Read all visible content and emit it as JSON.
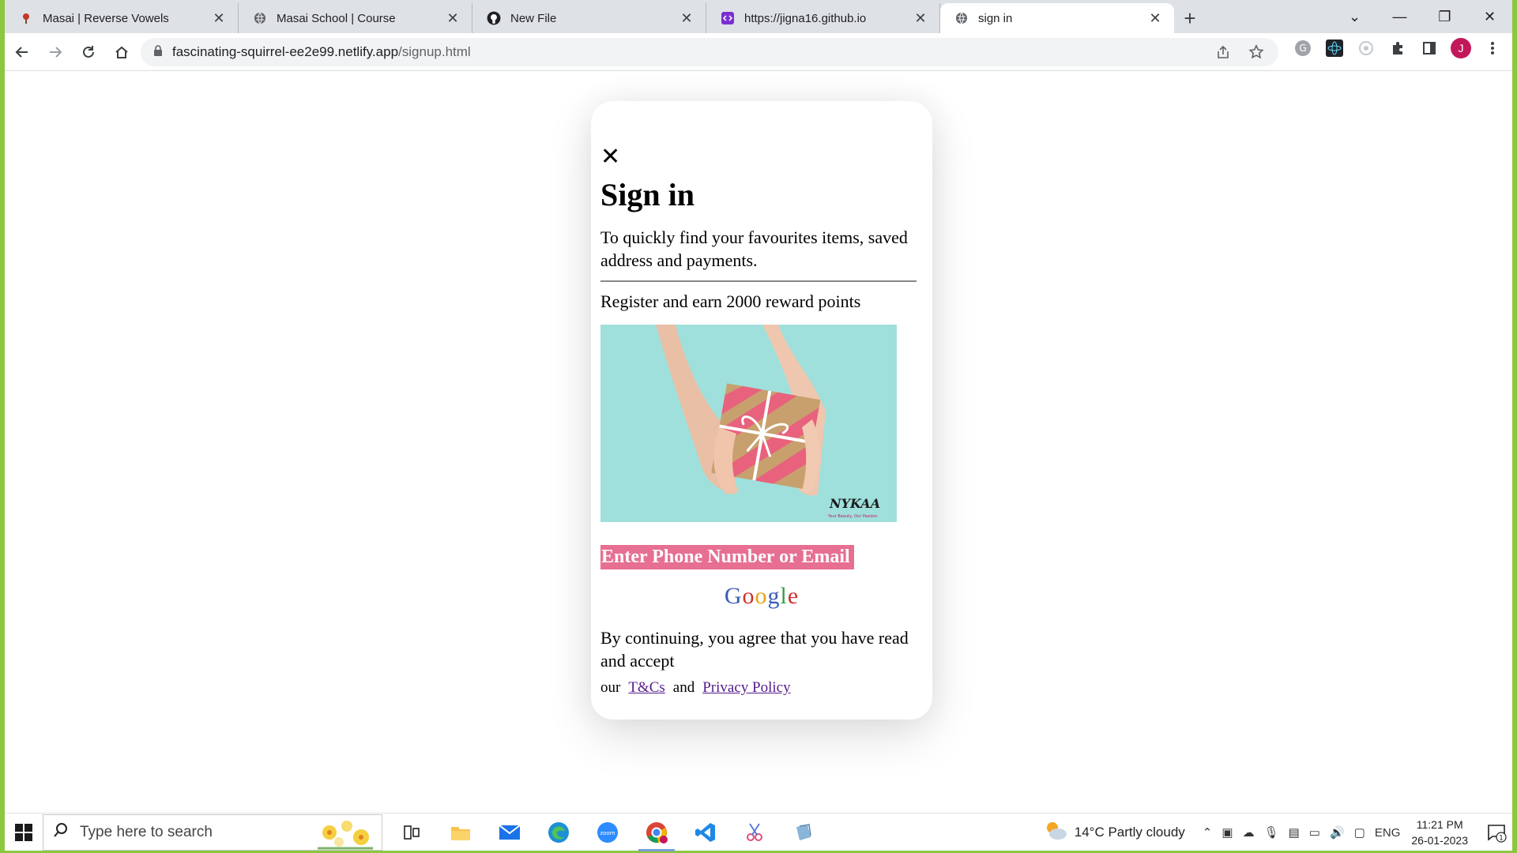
{
  "browser": {
    "tabs": [
      {
        "title": "Masai | Reverse Vowels",
        "icon": "masai-favicon",
        "active": false
      },
      {
        "title": "Masai School | Course",
        "icon": "globe-favicon",
        "active": false
      },
      {
        "title": "New File",
        "icon": "github-favicon",
        "active": false
      },
      {
        "title": "https://jigna16.github.io",
        "icon": "code-favicon",
        "active": false
      },
      {
        "title": "sign in",
        "icon": "globe-favicon",
        "active": true
      }
    ],
    "url_domain": "fascinating-squirrel-ee2e99.netlify.app",
    "url_path": "/signup.html",
    "profile_initial": "J"
  },
  "page": {
    "close_glyph": "✕",
    "title": "Sign in",
    "subtitle": "To quickly find your favourites items, saved address and payments.",
    "reward_text": "Register and earn 2000 reward points",
    "image_brand": "NYKAA",
    "image_tagline": "Your Beauty, Our Passion",
    "phone_button": "Enter Phone Number or Email",
    "google_letters": [
      {
        "ch": "G",
        "color": "#3b5bb5"
      },
      {
        "ch": "o",
        "color": "#d0312d"
      },
      {
        "ch": "o",
        "color": "#e6a30f"
      },
      {
        "ch": "g",
        "color": "#3b5bb5"
      },
      {
        "ch": "l",
        "color": "#3a9c45"
      },
      {
        "ch": "e",
        "color": "#d0312d"
      }
    ],
    "agree_text": "By continuing, you agree that you have read and accept",
    "legal_our": "our",
    "legal_tc": "T&Cs",
    "legal_and": "and",
    "legal_privacy": "Privacy Policy"
  },
  "taskbar": {
    "search_placeholder": "Type here to search",
    "weather": "14°C  Partly cloudy",
    "lang": "ENG",
    "time": "11:21 PM",
    "date": "26-01-2023",
    "notif_count": "1"
  },
  "colors": {
    "accent_pink": "#e66f92",
    "frame_green": "#8dc63f",
    "link_purple": "#551a8b"
  }
}
